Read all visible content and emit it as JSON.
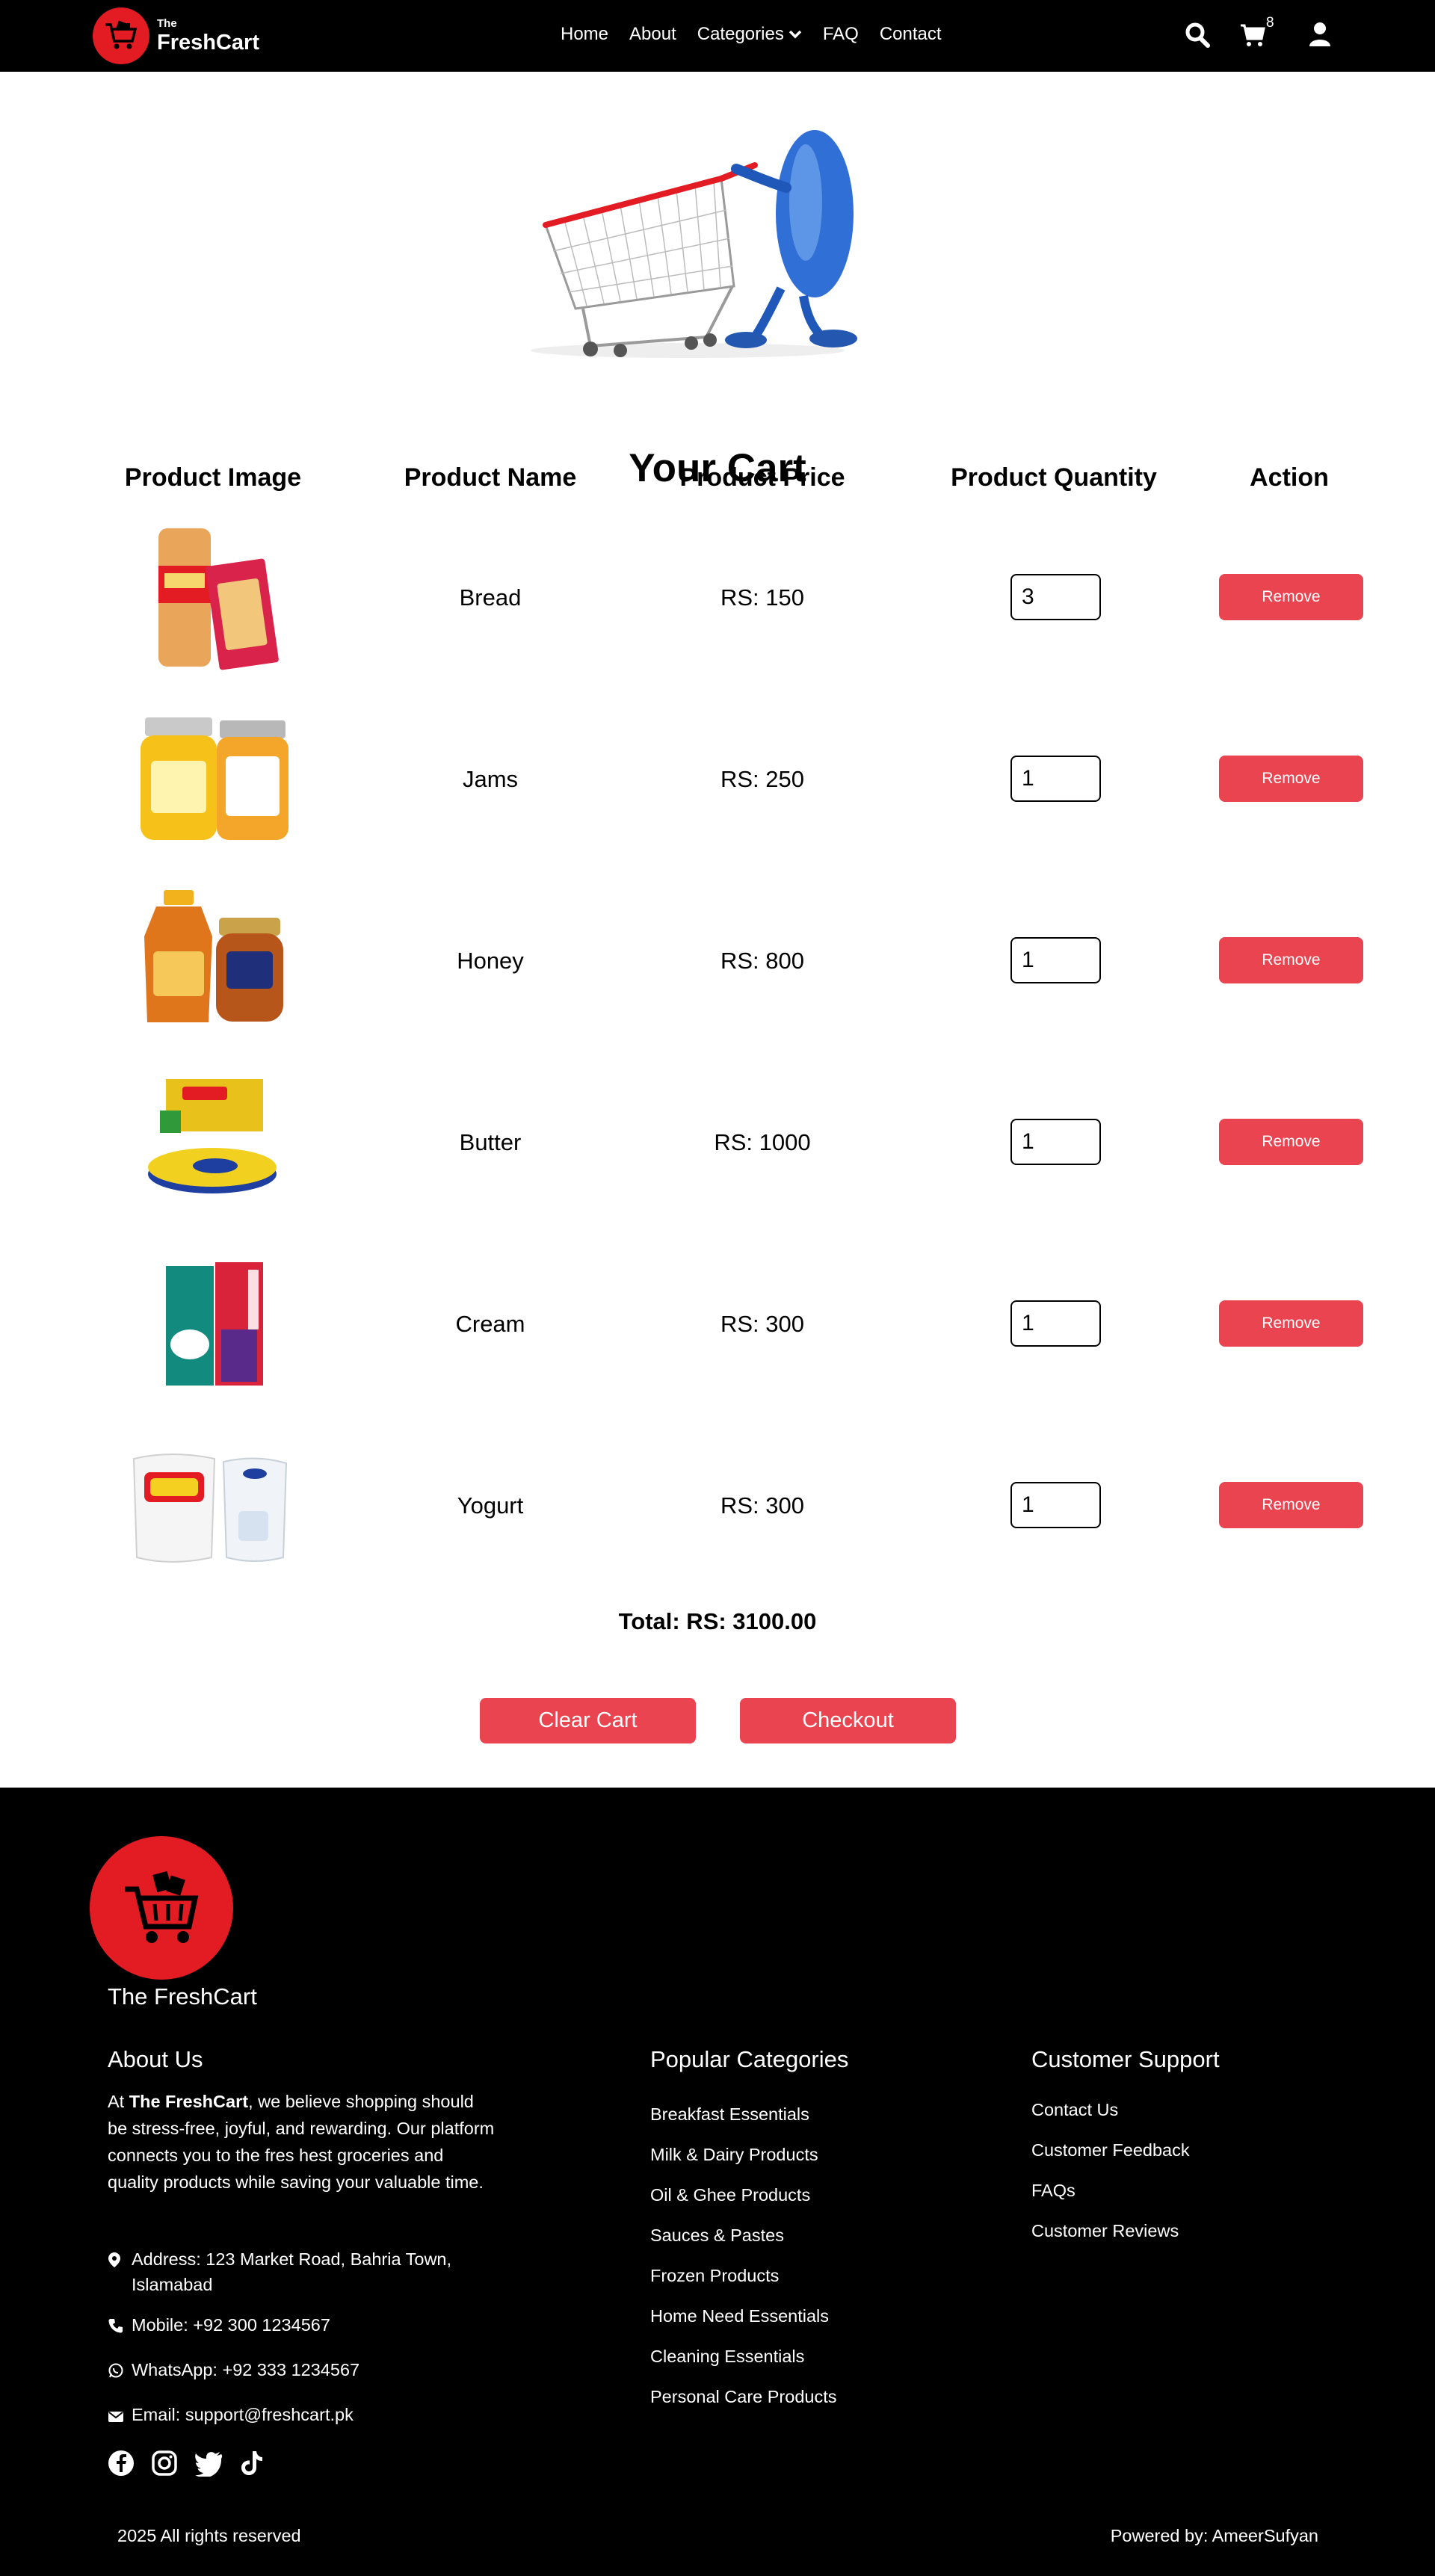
{
  "nav": {
    "brand_small": "The",
    "brand_big": "FreshCart",
    "links": [
      "Home",
      "About",
      "Categories",
      "FAQ",
      "Contact"
    ],
    "cart_count": "8"
  },
  "page": {
    "title": "Your Cart"
  },
  "table": {
    "headers": [
      "Product Image",
      "Product Name",
      "Product Price",
      "Product Quantity",
      "Action"
    ],
    "rows": [
      {
        "name": "Bread",
        "price": "RS: 150",
        "qty": "3",
        "action": "Remove"
      },
      {
        "name": "Jams",
        "price": "RS: 250",
        "qty": "1",
        "action": "Remove"
      },
      {
        "name": "Honey",
        "price": "RS: 800",
        "qty": "1",
        "action": "Remove"
      },
      {
        "name": "Butter",
        "price": "RS: 1000",
        "qty": "1",
        "action": "Remove"
      },
      {
        "name": "Cream",
        "price": "RS: 300",
        "qty": "1",
        "action": "Remove"
      },
      {
        "name": "Yogurt",
        "price": "RS: 300",
        "qty": "1",
        "action": "Remove"
      }
    ]
  },
  "summary": {
    "total": "Total: RS: 3100.00"
  },
  "buttons": {
    "clear": "Clear Cart",
    "checkout": "Checkout"
  },
  "footer": {
    "brand": "The FreshCart",
    "about_heading": "About Us",
    "about_prefix": "At ",
    "about_bold": "The FreshCart",
    "about_suffix": ", we believe shopping should be stress-free, joyful, and rewarding. Our platform connects you to the fres hest groceries and quality products while saving your valuable time.",
    "address": "Address: 123 Market Road, Bahria Town, Islamabad",
    "mobile": "Mobile: +92 300 1234567",
    "whatsapp": "WhatsApp: +92 333 1234567",
    "email": "Email: support@freshcart.pk",
    "categories_heading": "Popular Categories",
    "categories": [
      "Breakfast Essentials",
      "Milk & Dairy Products",
      "Oil & Ghee Products",
      "Sauces & Pastes",
      "Frozen Products",
      "Home Need Essentials",
      "Cleaning Essentials",
      "Personal Care Products"
    ],
    "support_heading": "Customer Support",
    "support": [
      "Contact Us",
      "Customer Feedback",
      "FAQs",
      "Customer Reviews"
    ],
    "copyright": "2025 All rights reserved",
    "powered": "Powered by: AmeerSufyan"
  },
  "colors": {
    "accent": "#e9444f",
    "brand_red": "#e31b23",
    "nav_bg": "#000000"
  },
  "icons": [
    "cart-logo-icon",
    "chevron-down-icon",
    "search-icon",
    "cart-icon",
    "user-icon",
    "location-icon",
    "phone-icon",
    "whatsapp-icon",
    "email-icon",
    "facebook-icon",
    "instagram-icon",
    "twitter-icon",
    "tiktok-icon"
  ]
}
